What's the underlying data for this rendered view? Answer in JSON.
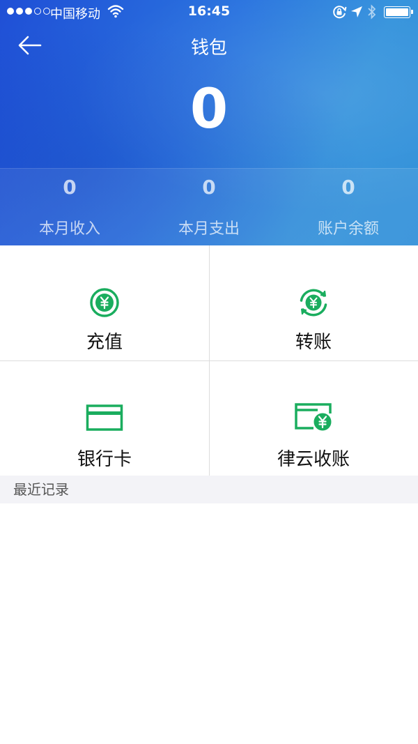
{
  "status_bar": {
    "carrier": "中国移动",
    "time": "16:45",
    "signal_strength": 3,
    "battery_level": 1.0
  },
  "header": {
    "title": "钱包",
    "total": "0",
    "back_icon": "arrow-left-icon"
  },
  "stats": [
    {
      "value": "0",
      "label": "本月收入"
    },
    {
      "value": "0",
      "label": "本月支出"
    },
    {
      "value": "0",
      "label": "账户余额"
    }
  ],
  "actions": [
    {
      "label": "充值",
      "icon": "yuan-circle-icon"
    },
    {
      "label": "转账",
      "icon": "yuan-transfer-icon"
    },
    {
      "label": "银行卡",
      "icon": "bank-card-icon"
    },
    {
      "label": "律云收账",
      "icon": "card-yuan-icon"
    }
  ],
  "recent": {
    "title": "最近记录",
    "items": []
  },
  "colors": {
    "header_start": "#1f4fd6",
    "header_end": "#3392dc",
    "accent_green": "#1aad5e",
    "section_bg": "#f3f3f7"
  }
}
